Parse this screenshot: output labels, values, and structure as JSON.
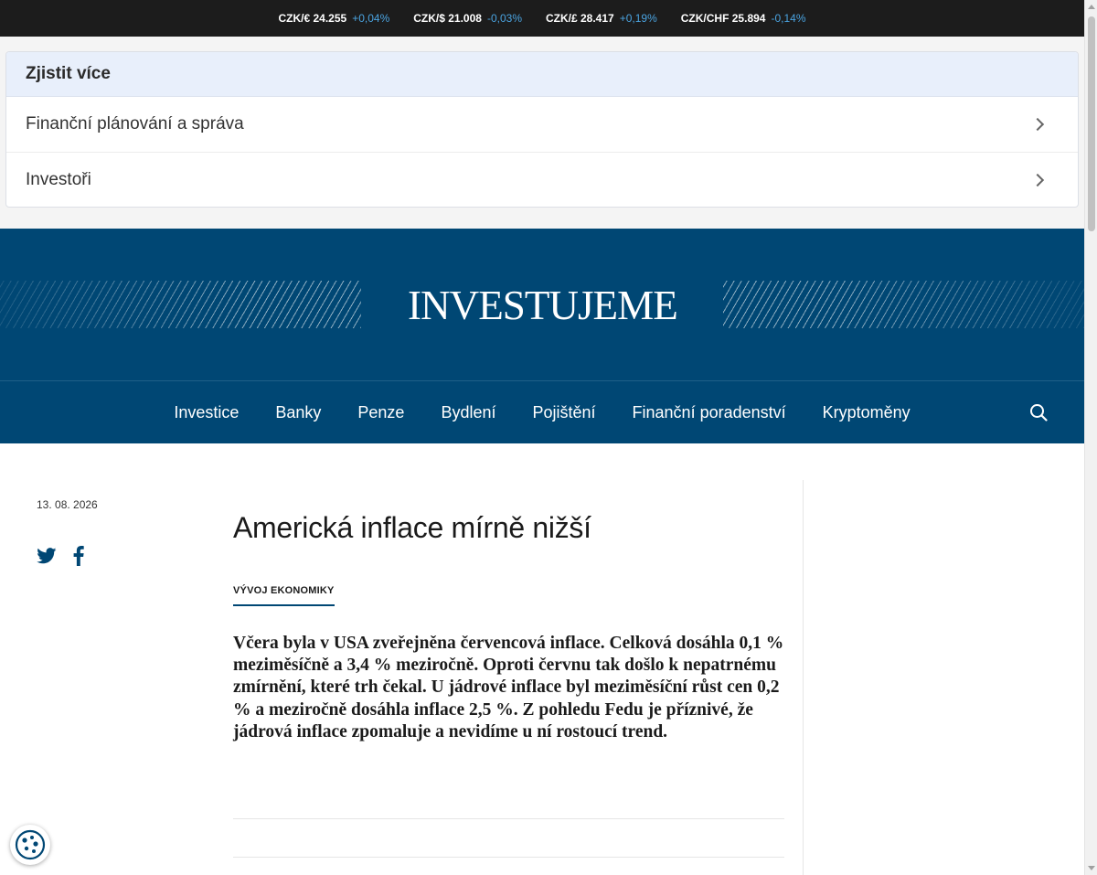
{
  "ticker": [
    {
      "pair": "CZK/€ 24.255",
      "change": "+0,04%"
    },
    {
      "pair": "CZK/$ 21.008",
      "change": "-0,03%"
    },
    {
      "pair": "CZK/£ 28.417",
      "change": "+0,19%"
    },
    {
      "pair": "CZK/CHF 25.894",
      "change": "-0,14%"
    }
  ],
  "learn_more": {
    "title": "Zjistit více",
    "items": [
      "Finanční plánování a správa",
      "Investoři"
    ]
  },
  "brand": {
    "logo": "INVESTUJEME",
    "color": "#004774"
  },
  "nav": {
    "items": [
      "Investice",
      "Banky",
      "Penze",
      "Bydlení",
      "Pojištění",
      "Finanční poradenství",
      "Kryptoměny"
    ]
  },
  "article": {
    "date": "13. 08. 2026",
    "title": "Americká inflace mírně nižší",
    "category": "VÝVOJ EKONOMIKY",
    "lead": "Včera byla v USA zveřejněna červencová inflace. Celková dosáhla 0,1 % meziměsíčně a 3,4 % meziročně. Oproti červnu tak došlo k nepatrnému zmírnění, které trh čekal. U jádrové inflace byl meziměsíční růst cen 0,2 % a meziročně dosáhla inflace 2,5 %. Z pohledu Fedu je příznivé, že jádrová inflace zpomaluje a nevidíme u ní rostoucí trend."
  },
  "icons": {
    "social": [
      "twitter-icon",
      "facebook-icon"
    ],
    "search": "search-icon",
    "cookie": "cookie-icon"
  }
}
